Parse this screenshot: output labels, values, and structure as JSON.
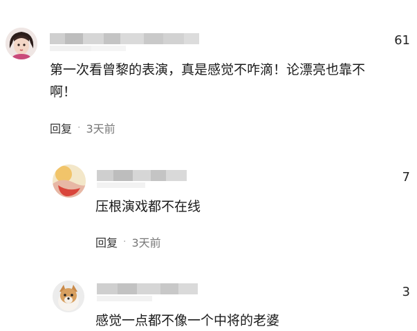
{
  "comments": [
    {
      "likes": "61",
      "text_line1": "第一次看曾黎的表演，真是感觉不咋滴！论漂亮也靠不",
      "text_line2": "啊！",
      "reply_label": "回复",
      "separator": "·",
      "time": "3天前"
    },
    {
      "likes": "7",
      "text": "压根演戏都不在线",
      "reply_label": "回复",
      "separator": "·",
      "time": "3天前"
    },
    {
      "likes": "3",
      "text": "感觉一点都不像一个中将的老婆"
    }
  ]
}
